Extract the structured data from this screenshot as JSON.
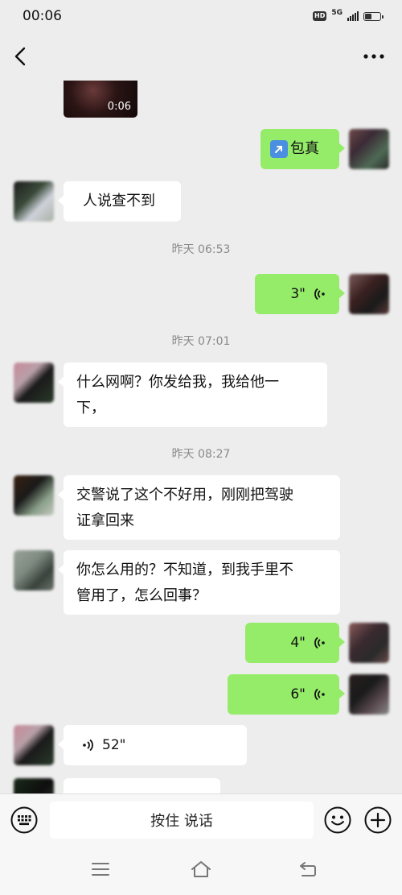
{
  "status_bar": {
    "time": "00:06",
    "hd_label": "HD",
    "network_label": "5G",
    "battery_percent": 45
  },
  "header": {
    "back_icon": "chevron-left-icon",
    "more_icon": "ellipsis-icon"
  },
  "messages": [
    {
      "id": "video",
      "direction": "incoming",
      "type": "video",
      "duration": "0:06"
    },
    {
      "id": "link",
      "direction": "outgoing",
      "type": "text",
      "emoji": "↗️",
      "text": "包真"
    },
    {
      "id": "text1",
      "direction": "incoming",
      "type": "text",
      "text": "人说查不到"
    },
    {
      "id": "ts1",
      "type": "timestamp",
      "text": "昨天 06:53"
    },
    {
      "id": "voice1",
      "direction": "outgoing",
      "type": "voice",
      "duration": "3\""
    },
    {
      "id": "ts2",
      "type": "timestamp",
      "text": "昨天 07:01"
    },
    {
      "id": "text2",
      "direction": "incoming",
      "type": "text",
      "lines": [
        "什么网啊？你发给我，我给他一",
        "下，"
      ]
    },
    {
      "id": "ts3",
      "type": "timestamp",
      "text": "昨天 08:27"
    },
    {
      "id": "text3",
      "direction": "incoming",
      "type": "text",
      "lines": [
        "交警说了这个不好用，刚刚把驾驶",
        "证拿回来"
      ]
    },
    {
      "id": "text4",
      "direction": "incoming",
      "type": "text",
      "lines": [
        "你怎么用的？不知道，到我手里不",
        "管用了，怎么回事？"
      ]
    },
    {
      "id": "voice2",
      "direction": "outgoing",
      "type": "voice",
      "duration": "4\""
    },
    {
      "id": "voice3",
      "direction": "outgoing",
      "type": "voice",
      "duration": "6\""
    },
    {
      "id": "voice4",
      "direction": "incoming",
      "type": "voice",
      "duration": "52\""
    }
  ],
  "input_bar": {
    "keyboard_icon": "keyboard-icon",
    "hold_to_talk_label": "按住 说话",
    "emoji_icon": "emoji-smile-icon",
    "plus_icon": "plus-circle-icon"
  },
  "nav_bar": {
    "menu_icon": "menu-icon",
    "home_icon": "home-icon",
    "back_icon": "back-icon"
  },
  "colors": {
    "background": "#ededed",
    "outgoing_bubble": "#95ec69",
    "incoming_bubble": "#ffffff",
    "timestamp_text": "#8a8a8a"
  }
}
